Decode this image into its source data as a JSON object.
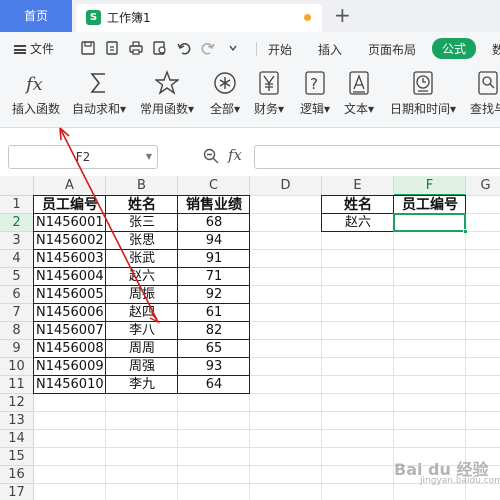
{
  "tabs": {
    "home_label": "首页",
    "doc_icon_letter": "S",
    "doc_name": "工作簿1",
    "new_tab": "+"
  },
  "menu": {
    "file_label": "文件",
    "tabs": [
      "开始",
      "插入",
      "页面布局",
      "公式",
      "数"
    ],
    "active_tab": "公式",
    "active_color": "#1aa260"
  },
  "ribbon": {
    "buttons": [
      {
        "label": "插入函数",
        "icon": "fx-icon"
      },
      {
        "label": "自动求和",
        "icon": "sigma-icon"
      },
      {
        "label": "常用函数",
        "icon": "star-icon"
      },
      {
        "label": "全部",
        "icon": "asterisk-icon"
      },
      {
        "label": "财务",
        "icon": "yen-icon"
      },
      {
        "label": "逻辑",
        "icon": "question-icon"
      },
      {
        "label": "文本",
        "icon": "text-a-icon"
      },
      {
        "label": "日期和时间",
        "icon": "clock-icon"
      },
      {
        "label": "查找与",
        "icon": "search-icon"
      }
    ]
  },
  "formula_bar": {
    "name_box": "F2",
    "fx_label": "fx",
    "value": ""
  },
  "sheet": {
    "columns": [
      "A",
      "B",
      "C",
      "D",
      "E",
      "F",
      "G"
    ],
    "selected_column": "F",
    "rows": [
      "1",
      "2",
      "3",
      "4",
      "5",
      "6",
      "7",
      "8",
      "9",
      "10",
      "11",
      "12",
      "13",
      "14",
      "15",
      "16",
      "17"
    ],
    "selected_row": "2",
    "table_headers": [
      "员工编号",
      "姓名",
      "销售业绩"
    ],
    "table_rows": [
      [
        "N1456001",
        "张三",
        "68"
      ],
      [
        "N1456002",
        "张思",
        "94"
      ],
      [
        "N1456003",
        "张武",
        "91"
      ],
      [
        "N1456004",
        "赵六",
        "71"
      ],
      [
        "N1456005",
        "周振",
        "92"
      ],
      [
        "N1456006",
        "赵四",
        "61"
      ],
      [
        "N1456007",
        "李八",
        "82"
      ],
      [
        "N1456008",
        "周周",
        "65"
      ],
      [
        "N1456009",
        "周强",
        "93"
      ],
      [
        "N1456010",
        "李九",
        "64"
      ]
    ],
    "lookup_headers": [
      "姓名",
      "员工编号"
    ],
    "lookup_values": [
      "赵六",
      ""
    ],
    "accent": "#1aa260"
  },
  "watermark": {
    "text": "Bai du 经验",
    "sub": "jingyan.baidu.com"
  }
}
